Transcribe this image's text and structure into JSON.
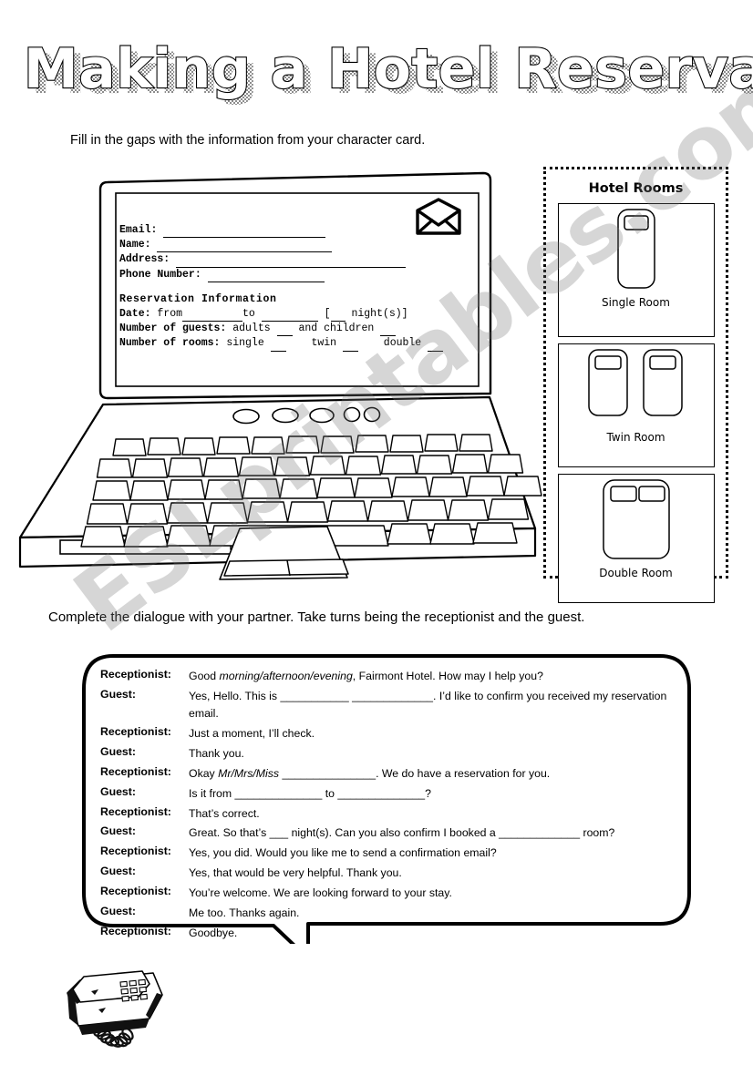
{
  "page": {
    "title": "Making a Hotel Reservation",
    "watermark": "ESLprintables.com"
  },
  "instructions": {
    "first": "Fill in the gaps with the information from your character card.",
    "second": "Complete the dialogue with your partner. Take turns being the receptionist and the guest."
  },
  "laptop_form": {
    "email_label": "Email:",
    "name_label": "Name:",
    "address_label": "Address:",
    "phone_label": "Phone Number:",
    "section_heading": "Reservation Information",
    "date_label": "Date:",
    "date_from": "from",
    "date_to": "to",
    "nights_open": "[",
    "nights_text": "night(s)]",
    "guests_label": "Number of guests:",
    "guests_adults": "adults",
    "guests_and": "and children",
    "rooms_label": "Number of rooms:",
    "rooms_single": "single",
    "rooms_twin": "twin",
    "rooms_double": "double",
    "envelope_icon": "envelope-icon"
  },
  "hotel_rooms": {
    "title": "Hotel Rooms",
    "items": [
      {
        "label": "Single Room",
        "icon": "single-bed-icon",
        "beds": 1
      },
      {
        "label": "Twin Room",
        "icon": "twin-bed-icon",
        "beds": 2
      },
      {
        "label": "Double Room",
        "icon": "double-bed-icon",
        "beds": 1
      }
    ]
  },
  "dialogue": {
    "lines": [
      {
        "speaker": "Receptionist:",
        "text": "Good <i>morning/afternoon/evening</i>, Fairmont Hotel. How may I help you?"
      },
      {
        "speaker": "Guest:",
        "text": "Yes, Hello. This is ___________ _____________. I’d like to confirm you received my reservation email."
      },
      {
        "speaker": "Receptionist:",
        "text": "Just a moment, I’ll check."
      },
      {
        "speaker": "Guest:",
        "text": "Thank you."
      },
      {
        "speaker": "Receptionist:",
        "text": "Okay <i>Mr/Mrs/Miss</i> _______________. We do have a reservation for you."
      },
      {
        "speaker": "Guest:",
        "text": "Is it from ______________ to ______________?"
      },
      {
        "speaker": "Receptionist:",
        "text": "That’s correct."
      },
      {
        "speaker": "Guest:",
        "text": "Great. So that’s ___ night(s). Can you also confirm I booked a _____________ room?"
      },
      {
        "speaker": "Receptionist:",
        "text": "Yes, you did. Would you like me to send a confirmation email?"
      },
      {
        "speaker": "Guest:",
        "text": "Yes, that would be very helpful. Thank you."
      },
      {
        "speaker": "Receptionist:",
        "text": "You’re welcome. We are looking forward to your stay."
      },
      {
        "speaker": "Guest:",
        "text": "Me too. Thanks again."
      },
      {
        "speaker": "Receptionist:",
        "text": "Goodbye."
      }
    ]
  },
  "icons": {
    "telephone": "telephone-icon",
    "laptop": "laptop-icon"
  },
  "colors": {
    "ink": "#000000",
    "paper": "#ffffff",
    "title_shadow": "#9a9a9a",
    "watermark": "#787878"
  }
}
